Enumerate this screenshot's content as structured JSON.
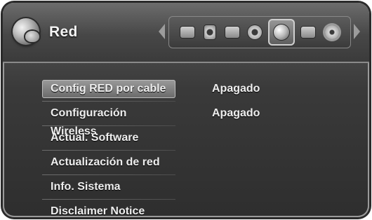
{
  "header": {
    "title": "Red",
    "icons": [
      {
        "name": "movie-icon"
      },
      {
        "name": "speaker-icon"
      },
      {
        "name": "tv-icon"
      },
      {
        "name": "settings-gears-icon"
      },
      {
        "name": "network-globe-icon",
        "selected": true
      },
      {
        "name": "folder-icon"
      },
      {
        "name": "gear-icon"
      }
    ]
  },
  "menu": {
    "items": [
      {
        "label": "Config RED por cable",
        "value": "Apagado",
        "selected": true
      },
      {
        "label": "Configuración Wireless",
        "value": "Apagado",
        "selected": false
      },
      {
        "label": "Actual. Software",
        "value": "",
        "selected": false
      },
      {
        "label": "Actualización de red",
        "value": "",
        "selected": false
      },
      {
        "label": "Info. Sistema",
        "value": "",
        "selected": false
      },
      {
        "label": "Disclaimer Notice",
        "value": "",
        "selected": false
      }
    ]
  }
}
